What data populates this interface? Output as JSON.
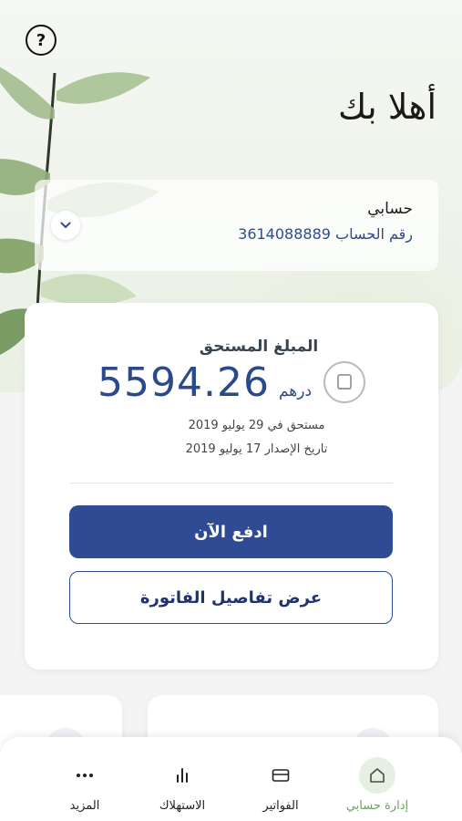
{
  "header": {
    "greeting": "أهلا بك",
    "help_icon": "question-circle-icon"
  },
  "account": {
    "title": "حسابي",
    "number_label": "رقم الحساب 3614088889",
    "toggle_icon": "chevron-down-icon"
  },
  "bill": {
    "due_label": "المبلغ المستحق",
    "amount": "5594.26",
    "currency": "درهم",
    "due_date": "مستحق في 29 يوليو 2019",
    "issue_date": "تاريخ الإصدار 17 يوليو 2019",
    "pay_label": "ادفع الآن",
    "details_label": "عرض تفاصيل الفاتورة",
    "bill_icon": "bill-icon"
  },
  "nav": {
    "items": [
      {
        "label": "إدارة حسابي",
        "icon": "home-icon",
        "active": true
      },
      {
        "label": "الفواتير",
        "icon": "card-icon",
        "active": false
      },
      {
        "label": "الاستهلاك",
        "icon": "bar-chart-icon",
        "active": false
      },
      {
        "label": "المزيد",
        "icon": "more-dots-icon",
        "active": false
      }
    ]
  },
  "colors": {
    "primary": "#2f4b93",
    "accent_green": "#6aa05f",
    "account_number": "#2f4b8a"
  }
}
